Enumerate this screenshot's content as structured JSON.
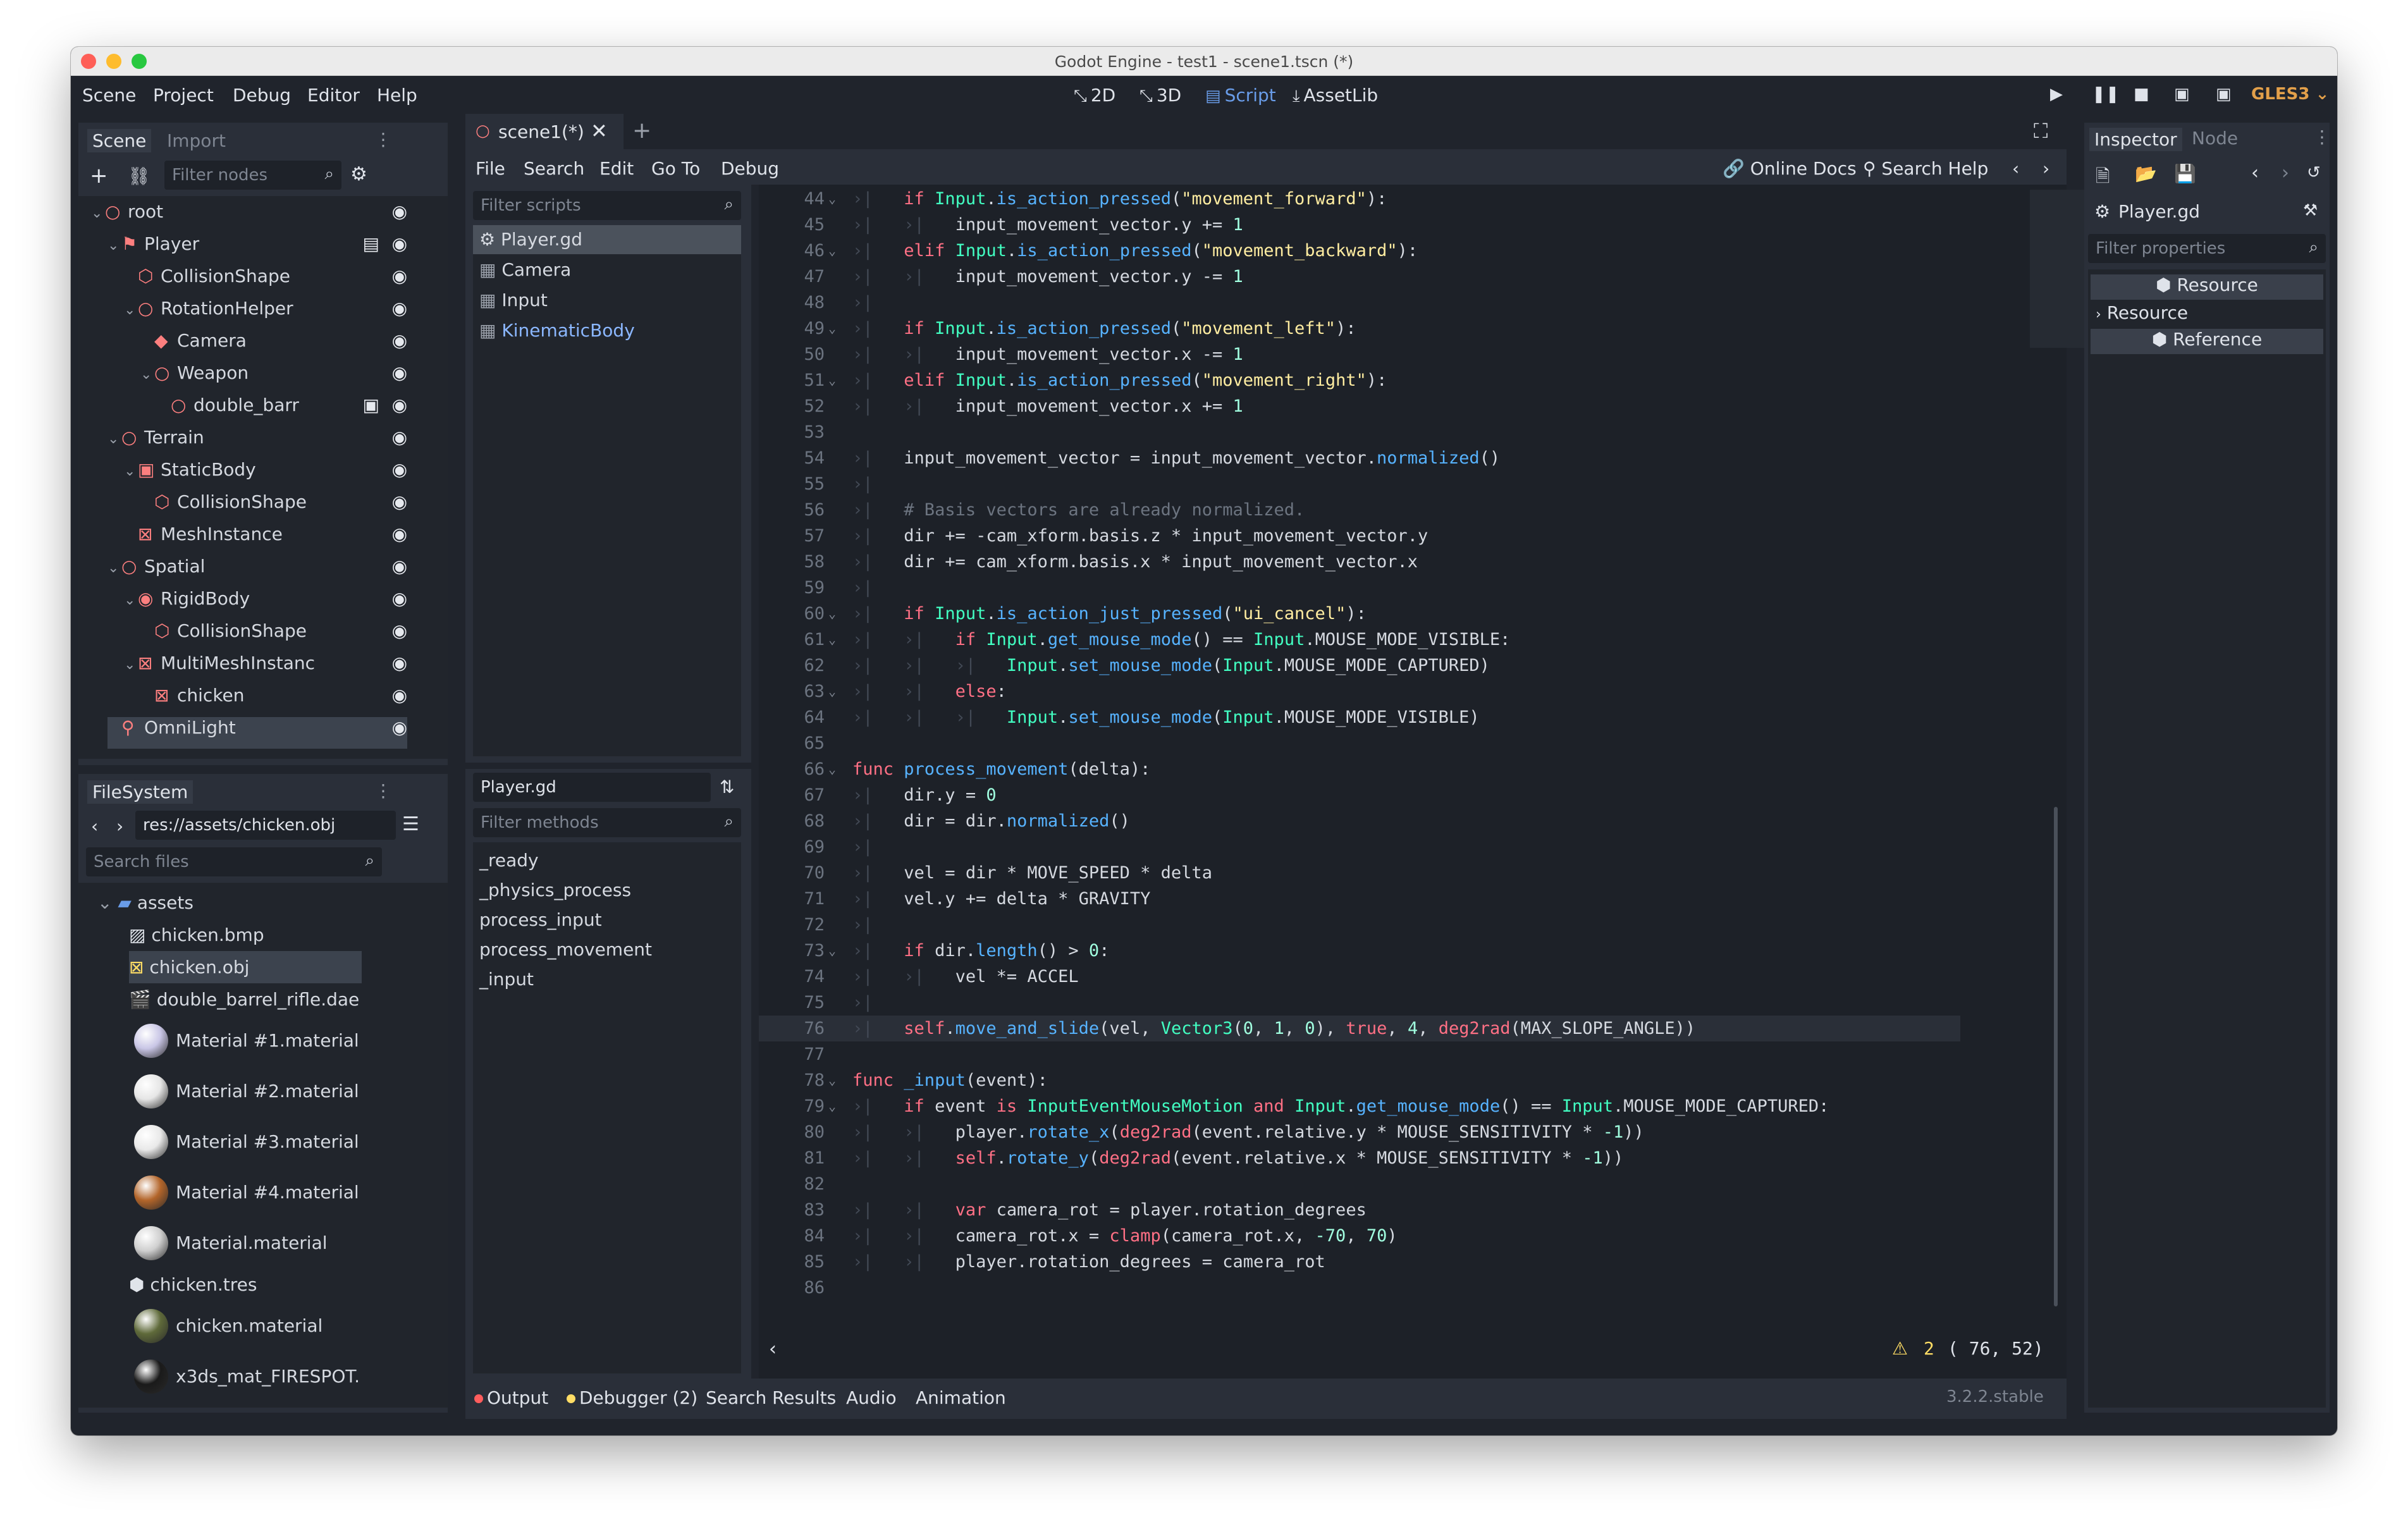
{
  "window": {
    "title": "Godot Engine - test1 - scene1.tscn (*)"
  },
  "menu": {
    "items": [
      "Scene",
      "Project",
      "Debug",
      "Editor",
      "Help"
    ]
  },
  "workspaces": [
    "2D",
    "3D",
    "Script",
    "AssetLib"
  ],
  "active_workspace": "Script",
  "renderer": "GLES3",
  "scene_dock": {
    "tabs": [
      "Scene",
      "Import"
    ],
    "filter_placeholder": "Filter nodes",
    "nodes": [
      {
        "label": "root",
        "icon": "node3d-icon"
      },
      {
        "label": "Player",
        "icon": "kinematic-body-icon"
      },
      {
        "label": "CollisionShape",
        "icon": "collision-shape-icon"
      },
      {
        "label": "RotationHelper",
        "icon": "spatial-icon"
      },
      {
        "label": "Camera",
        "icon": "camera-icon"
      },
      {
        "label": "Weapon",
        "icon": "spatial-icon"
      },
      {
        "label": "double_barr",
        "icon": "spatial-icon"
      },
      {
        "label": "Terrain",
        "icon": "spatial-icon"
      },
      {
        "label": "StaticBody",
        "icon": "static-body-icon"
      },
      {
        "label": "CollisionShape",
        "icon": "collision-shape-icon"
      },
      {
        "label": "MeshInstance",
        "icon": "mesh-instance-icon"
      },
      {
        "label": "Spatial",
        "icon": "spatial-icon"
      },
      {
        "label": "RigidBody",
        "icon": "rigid-body-icon"
      },
      {
        "label": "CollisionShape",
        "icon": "collision-shape-icon"
      },
      {
        "label": "MultiMeshInstanc",
        "icon": "multimesh-icon"
      },
      {
        "label": "chicken",
        "icon": "mesh-instance-icon"
      },
      {
        "label": "OmniLight",
        "icon": "omni-light-icon"
      }
    ]
  },
  "filesystem": {
    "title": "FileSystem",
    "path": "res://assets/chicken.obj",
    "search_placeholder": "Search files",
    "items": [
      {
        "label": "assets",
        "icon": "folder-icon"
      },
      {
        "label": "chicken.bmp",
        "icon": "image-icon"
      },
      {
        "label": "chicken.obj",
        "icon": "mesh-file-icon"
      },
      {
        "label": "double_barrel_rifle.dae",
        "icon": "scene-file-icon"
      },
      {
        "label": "Material #1.material",
        "icon": "material-sphere-icon",
        "color": "#c9c6e6"
      },
      {
        "label": "Material #2.material",
        "icon": "material-sphere-icon",
        "color": "#e6e6e6"
      },
      {
        "label": "Material #3.material",
        "icon": "material-sphere-icon",
        "color": "#e9e9e9"
      },
      {
        "label": "Material #4.material",
        "icon": "material-sphere-icon",
        "color": "#b3652a"
      },
      {
        "label": "Material.material",
        "icon": "material-sphere-icon",
        "color": "#cfcfcf"
      },
      {
        "label": "chicken.tres",
        "icon": "resource-icon"
      },
      {
        "label": "chicken.material",
        "icon": "material-sphere-icon",
        "color": "#5f6a3a"
      },
      {
        "label": "x3ds_mat_FIRESPOT.",
        "icon": "material-sphere-icon",
        "color": "#1a1a1a"
      }
    ]
  },
  "scene_tabs": {
    "active": "scene1(*)"
  },
  "script_menu": [
    "File",
    "Search",
    "Edit",
    "Go To",
    "Debug"
  ],
  "script_toolbar": {
    "online_docs": "Online Docs",
    "search_help": "Search Help"
  },
  "scripts": {
    "filter_placeholder": "Filter scripts",
    "items": [
      "Player.gd",
      "Camera",
      "Input",
      "KinematicBody"
    ],
    "current": "Player.gd",
    "methods_filter_placeholder": "Filter methods",
    "methods": [
      "_ready",
      "_physics_process",
      "process_input",
      "process_movement",
      "_input"
    ]
  },
  "code": {
    "lines": [
      {
        "n": "44",
        "fold": true
      },
      {
        "n": "45"
      },
      {
        "n": "46",
        "fold": true
      },
      {
        "n": "47"
      },
      {
        "n": "48"
      },
      {
        "n": "49",
        "fold": true
      },
      {
        "n": "50"
      },
      {
        "n": "51",
        "fold": true
      },
      {
        "n": "52"
      },
      {
        "n": "53"
      },
      {
        "n": "54"
      },
      {
        "n": "55"
      },
      {
        "n": "56"
      },
      {
        "n": "57"
      },
      {
        "n": "58"
      },
      {
        "n": "59"
      },
      {
        "n": "60",
        "fold": true
      },
      {
        "n": "61",
        "fold": true
      },
      {
        "n": "62"
      },
      {
        "n": "63",
        "fold": true
      },
      {
        "n": "64"
      },
      {
        "n": "65"
      },
      {
        "n": "66",
        "fold": true
      },
      {
        "n": "67"
      },
      {
        "n": "68"
      },
      {
        "n": "69"
      },
      {
        "n": "70"
      },
      {
        "n": "71"
      },
      {
        "n": "72"
      },
      {
        "n": "73",
        "fold": true
      },
      {
        "n": "74"
      },
      {
        "n": "75"
      },
      {
        "n": "76",
        "current": true
      },
      {
        "n": "77"
      },
      {
        "n": "78",
        "fold": true
      },
      {
        "n": "79",
        "fold": true
      },
      {
        "n": "80"
      },
      {
        "n": "81"
      },
      {
        "n": "82"
      },
      {
        "n": "83"
      },
      {
        "n": "84"
      },
      {
        "n": "85"
      },
      {
        "n": "86"
      }
    ],
    "warning_count": "2",
    "cursor_pos": "( 76, 52)"
  },
  "bottom_tabs": [
    "Output",
    "Debugger (2)",
    "Search Results",
    "Audio",
    "Animation"
  ],
  "version": "3.2.2.stable",
  "inspector": {
    "tabs": [
      "Inspector",
      "Node"
    ],
    "object": "Player.gd",
    "filter_placeholder": "Filter properties",
    "sections": [
      "Resource",
      "Resource",
      "Reference"
    ]
  }
}
